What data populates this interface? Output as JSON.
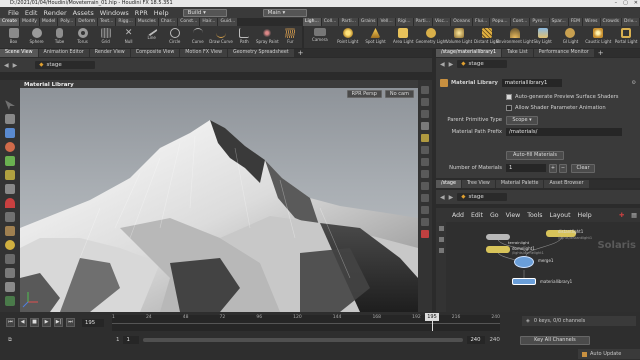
{
  "window": {
    "title": "D:/2021/01/04/Houdini/Moveterrain_01.hip - Houdini FX 18.5.351",
    "controls": [
      "–",
      "▢",
      "✕"
    ]
  },
  "menubar": {
    "items": [
      "File",
      "Edit",
      "Render",
      "Assets",
      "Windows",
      "RPR",
      "Help"
    ],
    "build_label": "Build",
    "main_label": "Main"
  },
  "shelf_left": {
    "tabs": [
      "Create",
      "Modify",
      "Model",
      "Poly...",
      "Deform",
      "Text...",
      "Rigg...",
      "Muscles",
      "Char...",
      "Const...",
      "Hair...",
      "Guid..."
    ],
    "tools": [
      "Box",
      "Sphere",
      "Tube",
      "Torus",
      "Grid",
      "Null",
      "Line",
      "Circle",
      "Curve",
      "Draw Curve",
      "Path",
      "Spray Paint",
      "Fur"
    ]
  },
  "shelf_right": {
    "tabs": [
      "Ligh...",
      "Coll...",
      "Parti...",
      "Grains",
      "Vell...",
      "Rigi...",
      "Parti...",
      "Visc...",
      "Oceans",
      "Flui...",
      "Popu...",
      "Cont...",
      "Pyro...",
      "Spar...",
      "FEM",
      "Wires",
      "Crowds",
      "Driv..."
    ],
    "tools": [
      "Camera",
      "Point Light",
      "Spot Light",
      "Area Light",
      "Geometry Light",
      "Volume Light",
      "Distant Light",
      "Environment Light",
      "Sky Light",
      "GI Light",
      "Caustic Light",
      "Portal Light"
    ]
  },
  "viewer_tabs": [
    "Scene View",
    "Animation Editor",
    "Render View",
    "Composite View",
    "Motion FX View",
    "Geometry Spreadsheet"
  ],
  "param_tabs": [
    "/stage/materiallibrary1",
    "Take List",
    "Performance Monitor"
  ],
  "viewer": {
    "path": "stage",
    "title": "Material Library",
    "renderer": "RPR Persp",
    "camera": "No cam"
  },
  "params": {
    "path": "stage",
    "node_type": "Material Library",
    "node_name": "materiallibrary1",
    "auto_generate_label": "Auto-generate Preview Surface Shaders",
    "auto_generate_checked": true,
    "allow_shader_label": "Allow Shader Parameter Animation",
    "allow_shader_checked": false,
    "parent_prim_type_label": "Parent Primitive Type",
    "parent_prim_type_value": "Scope",
    "material_path_prefix_label": "Material Path Prefix",
    "material_path_prefix_value": "/materials/",
    "auto_fill_label": "Auto-fill Materials",
    "num_materials_label": "Number of Materials",
    "num_materials_value": "1",
    "clear_label": "Clear"
  },
  "network": {
    "tabs": [
      "/stage",
      "Tree View",
      "Material Palette",
      "Asset Browser"
    ],
    "path": "stage",
    "menu": [
      "Add",
      "Edit",
      "Go",
      "View",
      "Tools",
      "Layout",
      "Help"
    ],
    "watermark": "Solaris",
    "nodes": [
      {
        "name": "distantlight1",
        "sub": "/lights/distantlight1"
      },
      {
        "name": "terrainlight",
        "sub": ""
      },
      {
        "name": "domelight1",
        "sub": "/lights/domelight1"
      },
      {
        "name": "merge1",
        "sub": ""
      },
      {
        "name": "materiallibrary1",
        "sub": ""
      }
    ]
  },
  "timeline": {
    "current_frame": "195",
    "ticks": [
      "1",
      "24",
      "48",
      "72",
      "96",
      "120",
      "144",
      "168",
      "192",
      "216",
      "240"
    ],
    "range_start": "1",
    "range_start2": "1",
    "range_end": "240",
    "range_end2": "240",
    "keys_info": "0 keys, 0/0 channels",
    "key_all_label": "Key All Channels",
    "auto_update_label": "Auto Update"
  },
  "colors": {
    "accent_orange": "#e0a030",
    "node_blue": "#6a9ed8",
    "node_yellow": "#d8c45a"
  }
}
